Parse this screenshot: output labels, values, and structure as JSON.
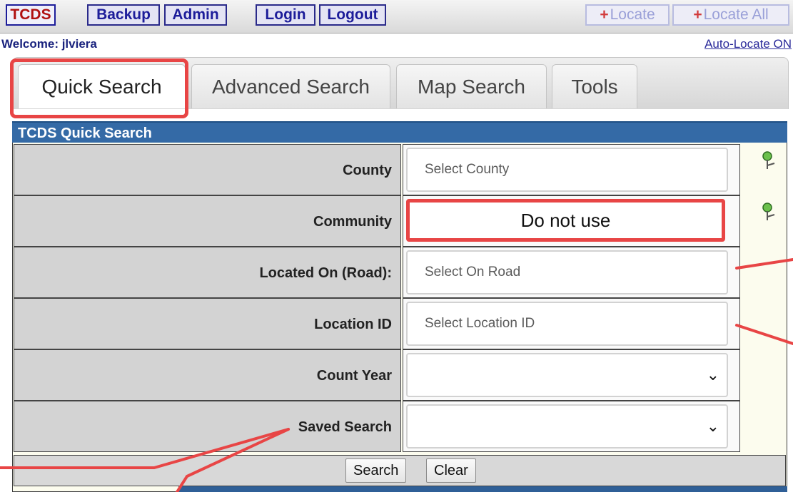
{
  "toolbar": {
    "tcds_label": "TCDS",
    "backup_label": "Backup",
    "admin_label": "Admin",
    "login_label": "Login",
    "logout_label": "Logout",
    "locate_label": "Locate",
    "locate_all_label": "Locate All"
  },
  "header": {
    "welcome": "Welcome: jlviera",
    "auto_locate": "Auto-Locate ON"
  },
  "tabs": [
    {
      "label": "Quick Search"
    },
    {
      "label": "Advanced Search"
    },
    {
      "label": "Map Search"
    },
    {
      "label": "Tools"
    }
  ],
  "panel": {
    "title": "TCDS Quick Search"
  },
  "form": {
    "county": {
      "label": "County",
      "placeholder": "Select County"
    },
    "community": {
      "label": "Community",
      "annotation": "Do not use"
    },
    "road": {
      "label": "Located On (Road):",
      "placeholder": "Select On Road"
    },
    "location_id": {
      "label": "Location ID",
      "placeholder": "Select Location ID"
    },
    "count_year": {
      "label": "Count Year",
      "value": ""
    },
    "saved_search": {
      "label": "Saved Search",
      "value": ""
    }
  },
  "buttons": {
    "search": "Search",
    "clear": "Clear"
  },
  "colors": {
    "accent": "#346aa6",
    "annotation_red": "#e84545",
    "label_cell": "#d3d3d3"
  },
  "icons": {
    "county_pin": "map-pin-icon",
    "community_pin": "map-pin-icon",
    "locate": "plus-icon"
  }
}
